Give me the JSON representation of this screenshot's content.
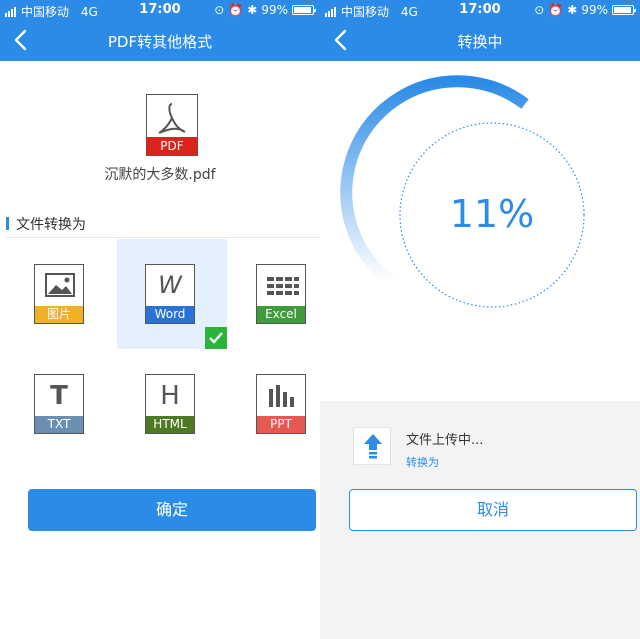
{
  "status_bar": {
    "carrier": "中国移动",
    "network": "4G",
    "time": "17:00",
    "battery": "99%"
  },
  "left_screen": {
    "title": "PDF转其他格式",
    "source_file": {
      "icon_label": "PDF",
      "name": "沉默的大多数.pdf"
    },
    "section_label": "文件转换为",
    "formats": [
      {
        "label": "图片",
        "selected": false,
        "color": "#f0b222"
      },
      {
        "label": "Word",
        "selected": true,
        "color": "#2a72d6"
      },
      {
        "label": "Excel",
        "selected": false,
        "color": "#3f9b3b"
      },
      {
        "label": "TXT",
        "selected": false,
        "color": "#6b8fb3"
      },
      {
        "label": "HTML",
        "selected": false,
        "color": "#4e7a22"
      },
      {
        "label": "PPT",
        "selected": false,
        "color": "#e45a52"
      }
    ],
    "confirm_label": "确定"
  },
  "right_screen": {
    "title": "转换中",
    "progress_percent_text": "11%",
    "progress_value": 0.11,
    "task": {
      "status_text": "文件上传中...",
      "subtext": "转换为"
    },
    "cancel_label": "取消"
  },
  "colors": {
    "primary": "#2b8be6",
    "selected_bg": "#e4f0fb",
    "check": "#2ab43a",
    "pdf_red": "#d9251c"
  }
}
